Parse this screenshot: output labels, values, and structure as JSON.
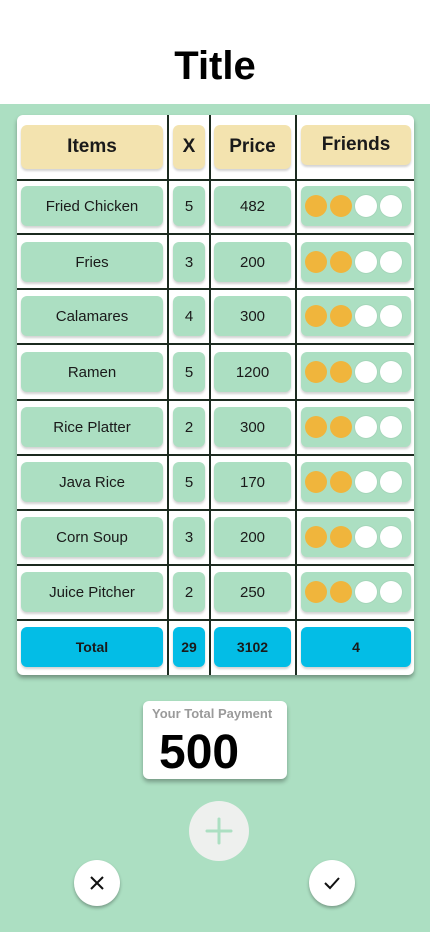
{
  "header": {
    "title": "Title"
  },
  "table": {
    "headers": {
      "items": "Items",
      "qty": "X",
      "price": "Price",
      "friends": "Friends"
    },
    "rows": [
      {
        "item": "Fried Chicken",
        "qty": "5",
        "price": "482",
        "friends_filled": 2,
        "friends_total": 4
      },
      {
        "item": "Fries",
        "qty": "3",
        "price": "200",
        "friends_filled": 2,
        "friends_total": 4
      },
      {
        "item": "Calamares",
        "qty": "4",
        "price": "300",
        "friends_filled": 2,
        "friends_total": 4
      },
      {
        "item": "Ramen",
        "qty": "5",
        "price": "1200",
        "friends_filled": 2,
        "friends_total": 4
      },
      {
        "item": "Rice Platter",
        "qty": "2",
        "price": "300",
        "friends_filled": 2,
        "friends_total": 4
      },
      {
        "item": "Java Rice",
        "qty": "5",
        "price": "170",
        "friends_filled": 2,
        "friends_total": 4
      },
      {
        "item": "Corn Soup",
        "qty": "3",
        "price": "200",
        "friends_filled": 2,
        "friends_total": 4
      },
      {
        "item": "Juice Pitcher",
        "qty": "2",
        "price": "250",
        "friends_filled": 2,
        "friends_total": 4
      }
    ],
    "total": {
      "label": "Total",
      "qty": "29",
      "price": "3102",
      "friends": "4"
    }
  },
  "payment": {
    "label": "Your Total Payment",
    "value": "500"
  },
  "actions": {
    "add_icon": "plus-icon",
    "cancel_icon": "close-icon",
    "confirm_icon": "check-icon"
  },
  "colors": {
    "background": "#acdfc2",
    "header_pill": "#f3e3af",
    "cell_pill": "#acdfc2",
    "total_pill": "#03bde6",
    "friend_on": "#f0b53c",
    "friend_off": "#ffffff"
  }
}
